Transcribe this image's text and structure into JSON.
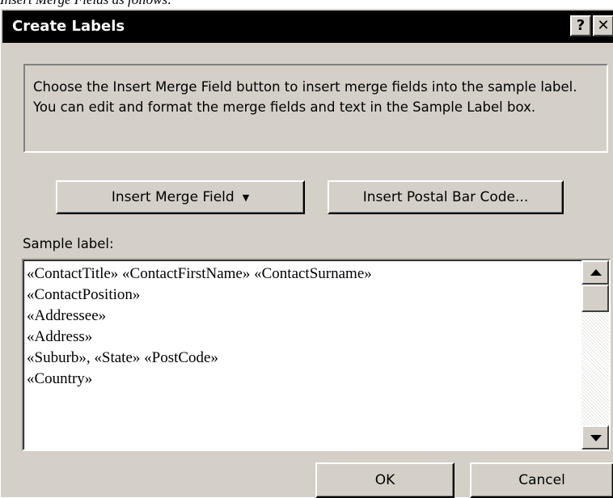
{
  "doc_caption": "Insert Merge Fields as follows:",
  "window": {
    "title": "Create Labels",
    "help_glyph": "?",
    "close_glyph": "✕"
  },
  "description": "Choose the Insert Merge Field button to insert merge fields into the sample label.  You can edit and format the merge fields and text in the Sample Label box.",
  "buttons": {
    "insert_merge_field": "Insert Merge Field",
    "insert_merge_field_caret": "▼",
    "insert_postal_bar_code": "Insert Postal Bar Code...",
    "ok": "OK",
    "cancel": "Cancel"
  },
  "sample": {
    "label": "Sample label:",
    "lines": [
      "«ContactTitle» «ContactFirstName» «ContactSurname»",
      "«ContactPosition»",
      "«Addressee»",
      "«Address»",
      "«Suburb», «State» «PostCode»",
      "«Country»"
    ]
  },
  "icons": {
    "help": "question-icon",
    "close": "close-icon",
    "scroll_up": "arrow-up-icon",
    "scroll_down": "arrow-down-icon",
    "dropdown": "caret-down-icon"
  }
}
